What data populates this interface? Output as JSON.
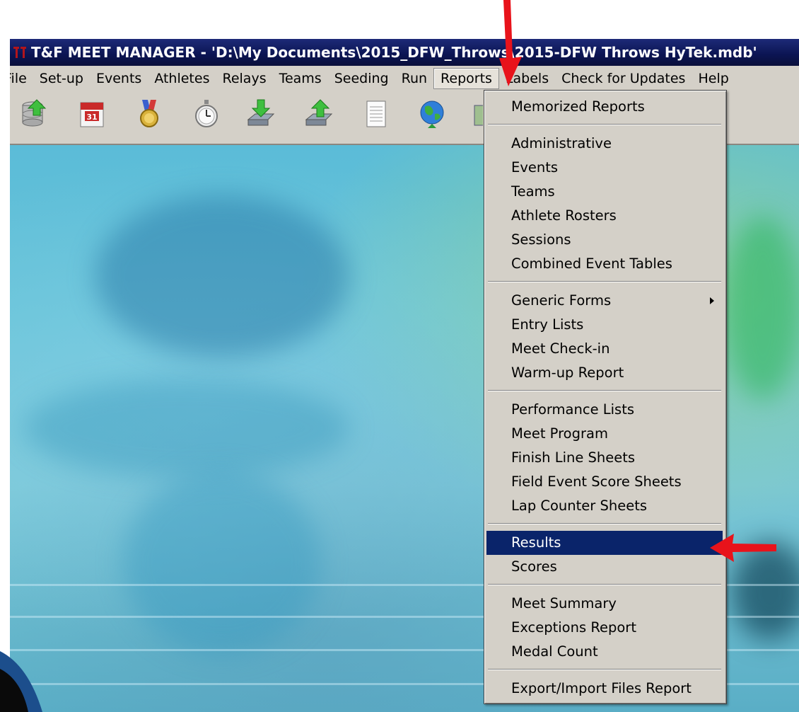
{
  "window": {
    "title": "T&F MEET MANAGER - 'D:\\My Documents\\2015_DFW_Throws\\2015-DFW Throws HyTek.mdb'"
  },
  "menubar": {
    "items": [
      {
        "label": "File"
      },
      {
        "label": "Set-up"
      },
      {
        "label": "Events"
      },
      {
        "label": "Athletes"
      },
      {
        "label": "Relays"
      },
      {
        "label": "Teams"
      },
      {
        "label": "Seeding"
      },
      {
        "label": "Run"
      },
      {
        "label": "Reports",
        "active": true
      },
      {
        "label": "Labels"
      },
      {
        "label": "Check for Updates"
      },
      {
        "label": "Help"
      }
    ]
  },
  "toolbar": {
    "icons": [
      "database-upload-icon",
      "calendar-icon",
      "medal-icon",
      "stopwatch-icon",
      "import-icon",
      "export-icon",
      "notepad-icon",
      "globe-icon",
      "partial-icon"
    ],
    "calendar_day": "31"
  },
  "reports_menu": {
    "group1": [
      "Memorized Reports"
    ],
    "group2": [
      "Administrative",
      "Events",
      "Teams",
      "Athlete Rosters",
      "Sessions",
      "Combined Event Tables"
    ],
    "group3": [
      "Generic Forms",
      "Entry Lists",
      "Meet Check-in",
      "Warm-up Report"
    ],
    "group4": [
      "Performance Lists",
      "Meet Program",
      "Finish Line Sheets",
      "Field Event Score Sheets",
      "Lap Counter Sheets"
    ],
    "group5": [
      "Results",
      "Scores"
    ],
    "group6": [
      "Meet Summary",
      "Exceptions Report",
      "Medal Count"
    ],
    "group7": [
      "Export/Import Files Report"
    ],
    "highlighted": "Results"
  },
  "colors": {
    "titlebar": "#0b1452",
    "menu_bg": "#d4d0c8",
    "highlight": "#0a246a",
    "annotation_arrow": "#e8131b"
  }
}
